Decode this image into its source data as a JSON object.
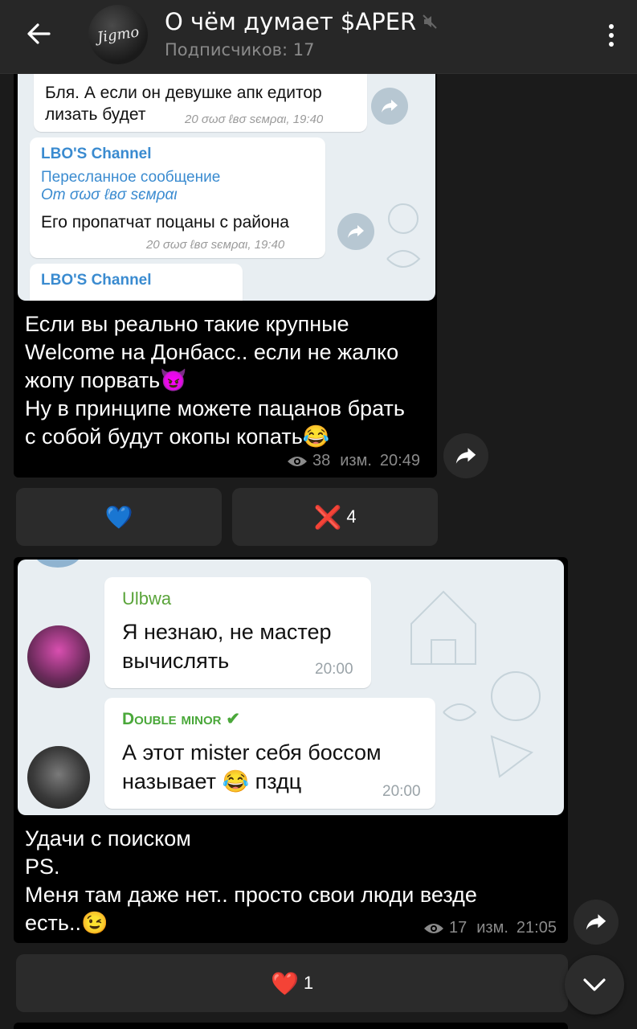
{
  "header": {
    "title": "О чём думает $APER",
    "subtitle": "Подписчиков: 17",
    "avatar_text": "Jigmo",
    "icons": [
      "back-arrow-icon",
      "muted-icon",
      "more-vert-icon"
    ]
  },
  "message1": {
    "screenshot": {
      "bubble1_text_line1": "Бля. А если он девушке апк едитор",
      "bubble1_text_line2": "лизать будет",
      "bubble1_meta": "20  σωσ ℓвσ ѕємραι, 19:40",
      "bubble2_channel": "LBO'S Channel",
      "bubble2_fwd_line1": "Пересланное сообщение",
      "bubble2_fwd_line2": "От σωσ ℓвσ ѕємραι",
      "bubble2_text": "Его пропатчат поцаны с района",
      "bubble2_meta": "20  σωσ ℓвσ ѕємραι, 19:40",
      "bubble3_channel": "LBO'S Channel"
    },
    "caption_line1": "Если вы реально такие крупные",
    "caption_line2": "Welcome на Донбасс.. если не жалко",
    "caption_line3": "жопу порвать😈",
    "caption_line4": "Ну в принципе можете пацанов брать",
    "caption_line5": "с собой будут окопы копать😂",
    "views": "38",
    "edited": "изм.",
    "time": "20:49"
  },
  "reactions1": {
    "left_emoji": "💙",
    "right_emoji": "❌",
    "right_count": "4"
  },
  "message2": {
    "screenshot": {
      "bubble1_name": "Ulbwa",
      "bubble1_line1": "Я незнаю, не мастер",
      "bubble1_line2": "вычислять",
      "bubble1_time": "20:00",
      "bubble2_name": "Double minor ✔",
      "bubble2_line1": "А этот mister себя боссом",
      "bubble2_line2": "называет 😂 пздц",
      "bubble2_time": "20:00"
    },
    "caption_line1": "Удачи с поиском",
    "caption_line2": "PS.",
    "caption_line3": "Меня там даже нет.. просто свои люди везде",
    "caption_line4": "есть..😉",
    "views": "17",
    "edited": "изм.",
    "time": "21:05"
  },
  "reactions2": {
    "emoji": "❤️",
    "count": "1"
  },
  "colors": {
    "background": "#1b1b1b",
    "header": "#272727",
    "bubble": "#000000",
    "reaction": "#2b2b2b",
    "link_blue": "#3a8bd0"
  }
}
